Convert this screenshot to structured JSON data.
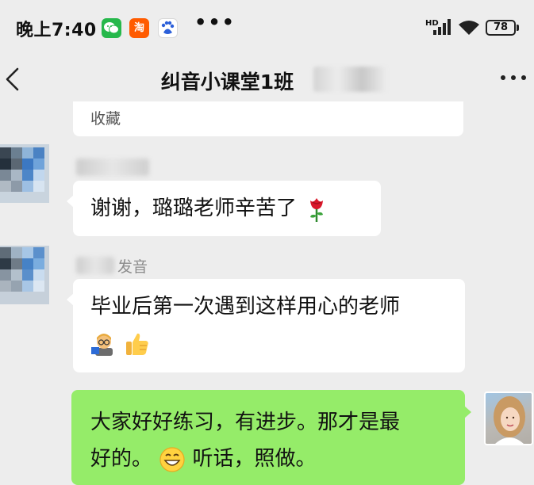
{
  "status_bar": {
    "time": "晚上7:40",
    "apps": [
      "wechat-icon",
      "taobao-icon",
      "baidu-icon"
    ],
    "taobao_label": "淘",
    "more": "•••",
    "hd": "HD",
    "battery": "78"
  },
  "header": {
    "title": "纠音小课堂1班"
  },
  "messages": [
    {
      "type": "received",
      "text": "收藏"
    },
    {
      "type": "received",
      "sender": "",
      "text": "谢谢，璐璐老师辛苦了",
      "emoji": "rose-icon"
    },
    {
      "type": "received",
      "sender": "发音",
      "text": "毕业后第一次遇到这样用心的老师",
      "emoji": [
        "teacher-emoji-icon",
        "thumbs-up-icon"
      ]
    },
    {
      "type": "sent",
      "text_line1": "大家好好练习，有进步。那才是最",
      "text_line2_a": "好的。",
      "text_line2_b": "听话，照做。",
      "emoji": "grin-emoji-icon"
    }
  ],
  "colors": {
    "background": "#ededed",
    "sent_bubble": "#95ec69",
    "received_bubble": "#ffffff"
  }
}
